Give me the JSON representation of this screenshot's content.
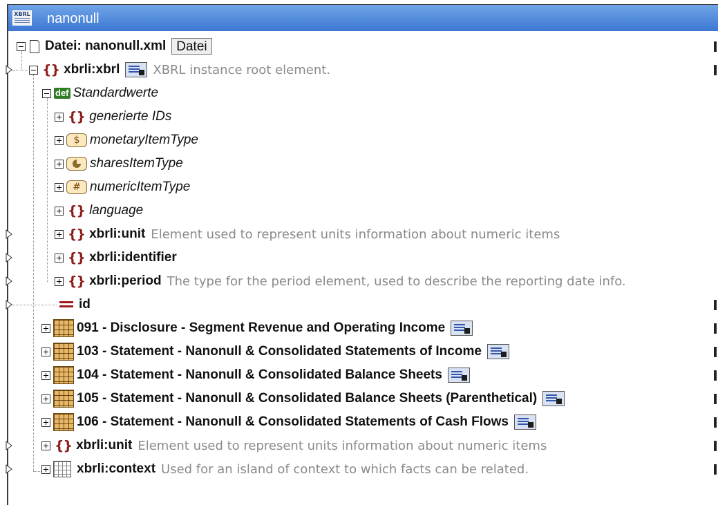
{
  "window": {
    "title": "nanonull"
  },
  "root_file": {
    "label": "Datei: nanonull.xml",
    "button_label": "Datei"
  },
  "root_element": {
    "name": "xbrli:xbrl",
    "description": "XBRL instance root element."
  },
  "defaults_group": {
    "label": "Standardwerte"
  },
  "defaults_items": [
    {
      "name": "generierte IDs",
      "icon": "braces-icon",
      "style": "italic"
    },
    {
      "name": "monetaryItemType",
      "icon": "dollar-icon",
      "style": "italic"
    },
    {
      "name": "sharesItemType",
      "icon": "pie-icon",
      "style": "italic"
    },
    {
      "name": "numericItemType",
      "icon": "hash-icon",
      "style": "italic"
    },
    {
      "name": "language",
      "icon": "braces-icon",
      "style": "italic"
    },
    {
      "name": "xbrli:unit",
      "icon": "braces-icon",
      "style": "bold",
      "description": "Element used to represent units information about numeric items"
    },
    {
      "name": "xbrli:identifier",
      "icon": "braces-icon",
      "style": "bold",
      "description": ""
    },
    {
      "name": "xbrli:period",
      "icon": "braces-icon",
      "style": "bold",
      "description": "The type for the period element, used to describe the reporting date info."
    }
  ],
  "id_attribute": {
    "name": "id"
  },
  "hypercubes": [
    {
      "label": "091 - Disclosure - Segment Revenue and Operating Income"
    },
    {
      "label": "103 - Statement - Nanonull & Consolidated Statements of Income"
    },
    {
      "label": "104 - Statement - Nanonull & Consolidated Balance Sheets"
    },
    {
      "label": "105 - Statement - Nanonull & Consolidated Balance Sheets (Parenthetical)"
    },
    {
      "label": "106 - Statement - Nanonull & Consolidated Statements of Cash Flows"
    }
  ],
  "unit_element": {
    "name": "xbrli:unit",
    "description": "Element used to represent units information about numeric items"
  },
  "context_element": {
    "name": "xbrli:context",
    "description": "Used for an island of context to which facts can be related."
  },
  "colors": {
    "title_bar": "#3c78d4",
    "element_icon": "#8b1a1a",
    "def_icon": "#2f7d23",
    "description_text": "#8a8a8a"
  }
}
